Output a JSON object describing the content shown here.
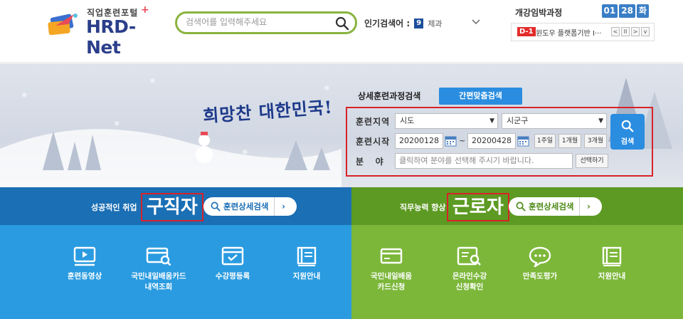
{
  "header": {
    "logo_sub": "직업훈련포털",
    "logo_main": "HRD-Net",
    "logo_plus": "+",
    "search_placeholder": "검색어를 입력해주세요",
    "popular_label": "인기검색어 :",
    "popular_rank": "9",
    "popular_keyword": "제과"
  },
  "deadline": {
    "title": "개강임박과정",
    "date": [
      "01",
      "28",
      "화"
    ],
    "tag": "D-1",
    "course": "윈도우 플랫폼기반 I···",
    "controls": [
      "<",
      "II",
      ">",
      "v"
    ]
  },
  "banner": {
    "slogan": "희망찬 대한민국!"
  },
  "advanced_search": {
    "title": "상세훈련과정검색",
    "quick_button": "간편맞춤검색",
    "region_label": "훈련지역",
    "region_sido": "시도",
    "region_sigungu": "시군구",
    "start_label": "훈련시작",
    "date_from": "20200128",
    "tilde": "~",
    "date_to": "20200428",
    "periods": [
      "1주일",
      "1개월",
      "3개월"
    ],
    "field_label": "분   야",
    "field_placeholder": "클릭하여 분야를 선택해 주시기 바랍니다.",
    "choose_button": "선택하기",
    "search_button": "검색"
  },
  "job_seeker": {
    "small": "성공적인 취업",
    "big": "구직자",
    "pill": "훈련상세검색",
    "menu": [
      {
        "icon": "video-icon",
        "label": "훈련동영상"
      },
      {
        "icon": "card-search-icon",
        "label": "국민내일배움카드\n내역조회"
      },
      {
        "icon": "check-window-icon",
        "label": "수강평등록"
      },
      {
        "icon": "book-icon",
        "label": "지원안내"
      }
    ]
  },
  "worker": {
    "small": "직무능력 향상",
    "big": "근로자",
    "pill": "훈련상세검색",
    "menu": [
      {
        "icon": "card-icon",
        "label": "국민내일배움\n카드신청"
      },
      {
        "icon": "doc-search-icon",
        "label": "온라인수강\n신청확인"
      },
      {
        "icon": "chat-icon",
        "label": "만족도평가"
      },
      {
        "icon": "book-icon",
        "label": "지원안내"
      }
    ]
  },
  "colors": {
    "brand_blue": "#2a8de0",
    "seeker_bar": "#1b6fb4",
    "seeker_bg": "#2a9be0",
    "worker_bar": "#5d9a23",
    "worker_bg": "#7cb73a",
    "highlight_red": "#d82229"
  }
}
